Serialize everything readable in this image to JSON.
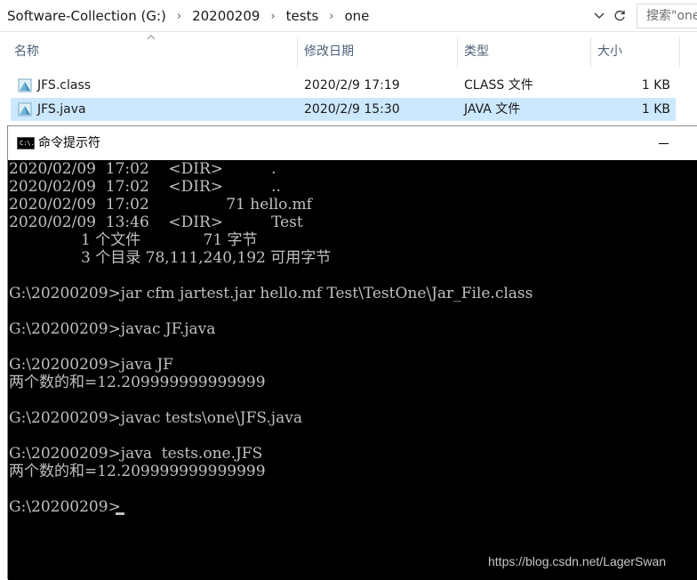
{
  "address_bar": {
    "crumbs": [
      "Software-Collection (G:)",
      "20200209",
      "tests",
      "one"
    ],
    "separator": "›",
    "search_placeholder": "搜索\"one\""
  },
  "columns": {
    "name": "名称",
    "modified": "修改日期",
    "type": "类型",
    "size": "大小"
  },
  "files": [
    {
      "name": "JFS.class",
      "modified": "2020/2/9 17:19",
      "type": "CLASS 文件",
      "size": "1 KB",
      "icon": "class-file-icon",
      "selected": false
    },
    {
      "name": "JFS.java",
      "modified": "2020/2/9 15:30",
      "type": "JAVA 文件",
      "size": "1 KB",
      "icon": "java-file-icon",
      "selected": true
    }
  ],
  "cmd": {
    "title": "命令提示符",
    "icon_text": "C:\\.",
    "lines": [
      "2020/02/09  17:02    <DIR>          .",
      "2020/02/09  17:02    <DIR>          ..",
      "2020/02/09  17:02                71 hello.mf",
      "2020/02/09  13:46    <DIR>          Test",
      "               1 个文件             71 字节",
      "               3 个目录 78,111,240,192 可用字节",
      "",
      "G:\\20200209>jar cfm jartest.jar hello.mf Test\\TestOne\\Jar_File.class",
      "",
      "G:\\20200209>javac JF.java",
      "",
      "G:\\20200209>java JF",
      "两个数的和=12.209999999999999",
      "",
      "G:\\20200209>javac tests\\one\\JFS.java",
      "",
      "G:\\20200209>java  tests.one.JFS",
      "两个数的和=12.209999999999999",
      "",
      "G:\\20200209>"
    ],
    "watermark": "https://blog.csdn.net/LagerSwan"
  },
  "colors": {
    "selection": "#cce8ff",
    "header_text": "#4c607a",
    "console_bg": "#000000",
    "console_text": "#c0c0c0"
  }
}
